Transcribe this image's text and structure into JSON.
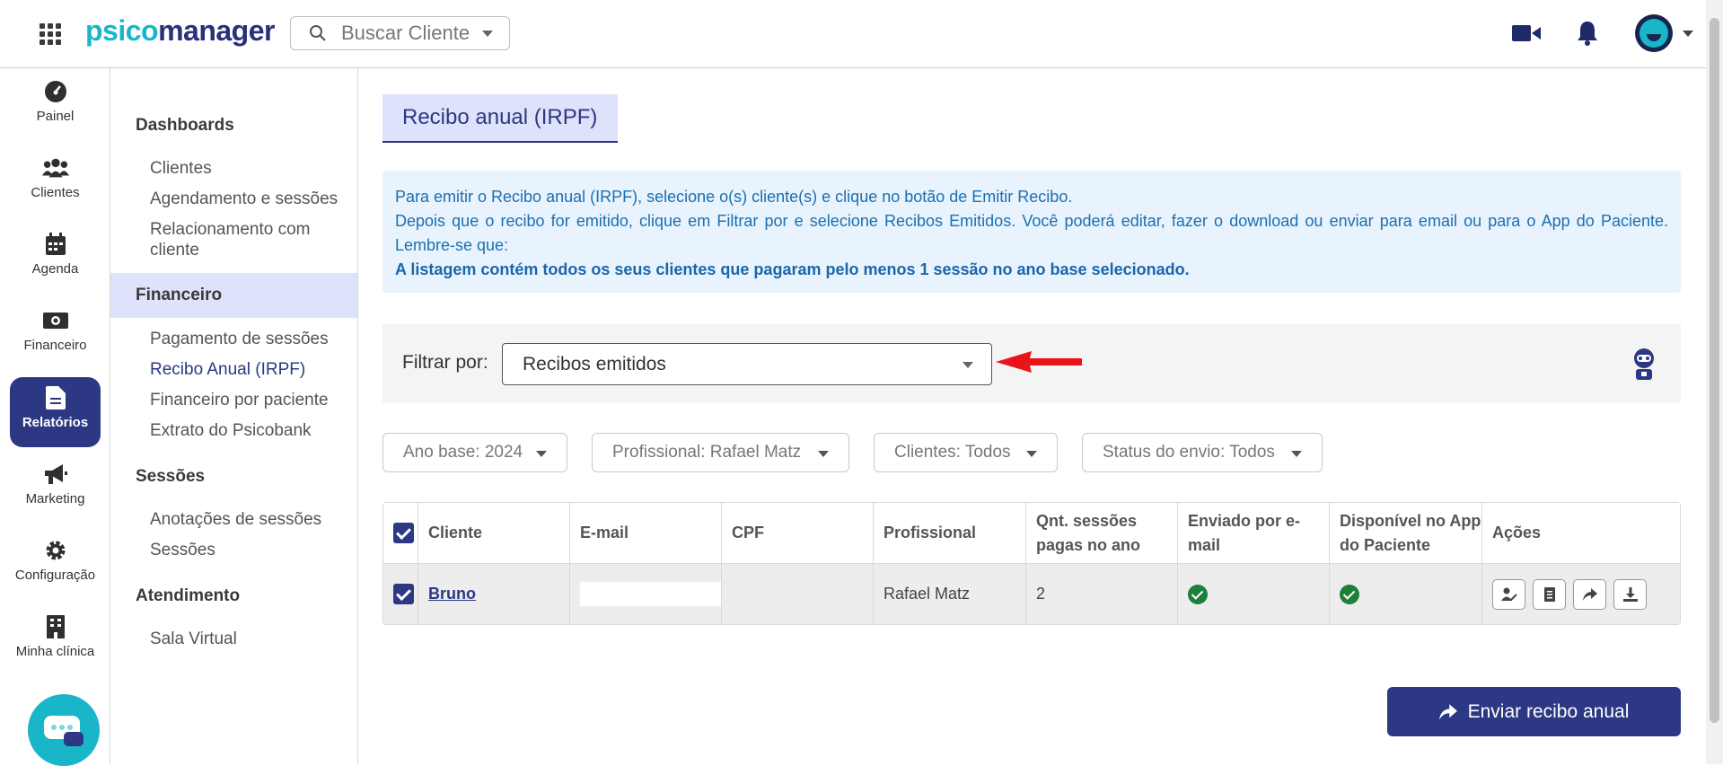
{
  "header": {
    "logo_part1": "psico",
    "logo_part2": "manager",
    "search_placeholder": "Buscar Cliente"
  },
  "rail": {
    "items": [
      {
        "label": "Painel",
        "icon": "dashboard-icon"
      },
      {
        "label": "Clientes",
        "icon": "users-icon"
      },
      {
        "label": "Agenda",
        "icon": "calendar-icon"
      },
      {
        "label": "Financeiro",
        "icon": "money-icon"
      },
      {
        "label": "Relatórios",
        "icon": "report-icon",
        "active": true
      },
      {
        "label": "Marketing",
        "icon": "megaphone-icon"
      },
      {
        "label": "Configuração",
        "icon": "gear-icon"
      },
      {
        "label": "Minha clínica",
        "icon": "building-icon"
      }
    ]
  },
  "submenu": {
    "dashboards": "Dashboards",
    "dashboards_items": [
      "Clientes",
      "Agendamento e sessões",
      "Relacionamento com cliente"
    ],
    "financeiro": "Financeiro",
    "financeiro_items": [
      "Pagamento de sessões",
      "Recibo Anual (IRPF)",
      "Financeiro por paciente",
      "Extrato do Psicobank"
    ],
    "sessoes": "Sessões",
    "sessoes_items": [
      "Anotações de sessões",
      "Sessões"
    ],
    "atendimento": "Atendimento",
    "atendimento_items": [
      "Sala Virtual"
    ]
  },
  "main": {
    "title": "Recibo anual (IRPF)",
    "info_line1": "Para emitir o Recibo anual (IRPF), selecione o(s) cliente(s) e clique no botão de Emitir Recibo.",
    "info_line2": "Depois que o recibo for emitido, clique em Filtrar por e selecione Recibos Emitidos. Você poderá editar, fazer o download ou enviar para email ou para o App do Paciente. Lembre-se que:",
    "info_bold": "A listagem contém todos os seus clientes que pagaram pelo menos 1 sessão no ano base selecionado.",
    "filter_label": "Filtrar por:",
    "filter_value": "Recibos emitidos",
    "chips": {
      "ano": "Ano base: 2024",
      "profissional": "Profissional: Rafael Matz",
      "clientes": "Clientes: Todos",
      "status": "Status do envio: Todos"
    },
    "table": {
      "headers": {
        "cliente": "Cliente",
        "email": "E-mail",
        "cpf": "CPF",
        "profissional": "Profissional",
        "qnt": "Qnt. sessões pagas no ano",
        "enviado": "Enviado por e-mail",
        "disponivel": "Disponível no App do Paciente",
        "acoes": "Ações"
      },
      "rows": [
        {
          "cliente": "Bruno",
          "email": "",
          "cpf": "",
          "profissional": "Rafael Matz",
          "qnt": "2"
        }
      ]
    },
    "send_button": "Enviar recibo anual"
  },
  "colors": {
    "brand_navy": "#2c3883",
    "brand_teal": "#19b5c9",
    "info_bg": "#e8f3fd",
    "success": "#1e7f3a",
    "arrow_red": "#e8141a"
  }
}
